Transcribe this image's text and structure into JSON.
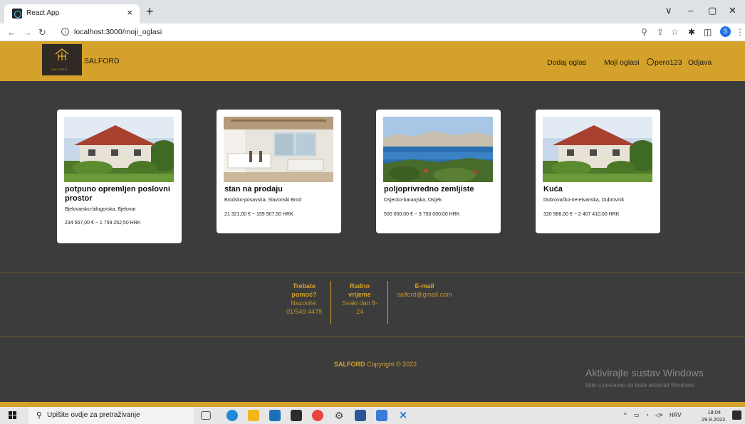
{
  "browser": {
    "tab_title": "React App",
    "tab_close": "×",
    "new_tab": "+",
    "url": "localhost:3000/moji_oglasi",
    "profile_initial": "S",
    "window_controls": [
      "∨",
      "–",
      "▢",
      "✕"
    ]
  },
  "header": {
    "logo_text": "SALFORD",
    "brand": "SALFORD",
    "nav": {
      "add": "Dodaj oglas",
      "my_ads": "Moji oglasi",
      "user": "pero123",
      "logout": "Odjava"
    }
  },
  "listings": [
    {
      "title": "potpuno opremljen poslovni prostor",
      "location": "Bjelovarsko-bilogorska, Bjelovar",
      "price": "234 567,00 € ~ 1 759 252,50 HRK",
      "image": "house"
    },
    {
      "title": "stan na prodaju",
      "location": "Brodsko-posavska, Slavonski Brod",
      "price": "21 321,00 € ~ 159 907,50 HRK",
      "image": "interior"
    },
    {
      "title": "poljoprivredno zemljiste",
      "location": "Osjecko-baranjska, Osijek",
      "price": "500 000,00 € ~ 3 750 000,00 HRK",
      "image": "sea"
    },
    {
      "title": "Kuća",
      "location": "Dubrovačko-neretvanska, Dubrovnik",
      "price": "320 988,00 € ~ 2 407 410,00 HRK",
      "image": "house"
    }
  ],
  "footer": {
    "help": {
      "h1": "Trebate",
      "h2": "pomoć?",
      "v1": "Nazovite:",
      "v2": "01/549 4478"
    },
    "hours": {
      "h1": "Radno",
      "h2": "vrijeme",
      "v1": "Svaki dan 8-",
      "v2": "24"
    },
    "email": {
      "h": "E-mail",
      "v": "salford@gmail.com"
    },
    "copyright_brand": "SALFORD",
    "copyright_text": "Copyright © 2022"
  },
  "watermark": {
    "line1": "Aktivirajte sustav Windows",
    "line2": "Idite u postavke da biste aktivirali Windows."
  },
  "taskbar": {
    "search_placeholder": "Upišite ovdje za pretraživanje",
    "lang": "HRV",
    "time": "18:04",
    "date": "29.9.2022."
  }
}
